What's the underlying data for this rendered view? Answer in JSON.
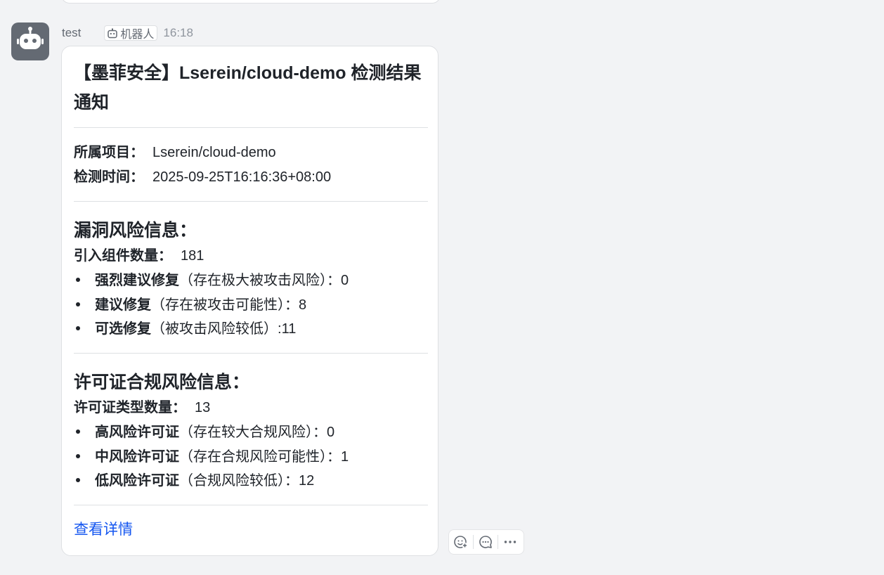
{
  "message": {
    "sender": "test",
    "bot_tag": "机器人",
    "time": "16:18"
  },
  "card": {
    "title": "【墨菲安全】Lserein/cloud-demo 检测结果通知",
    "project_label": "所属项目：",
    "project_value": "Lserein/cloud-demo",
    "time_label": "检测时间：",
    "time_value": "2025-09-25T16:16:36+08:00",
    "vuln": {
      "heading": "漏洞风险信息：",
      "count_label": "引入组件数量：",
      "count_value": "181",
      "items": [
        {
          "label": "强烈建议修复",
          "note": "（存在极大被攻击风险）：",
          "value": "0"
        },
        {
          "label": "建议修复",
          "note": "（存在被攻击可能性）：",
          "value": "8"
        },
        {
          "label": "可选修复",
          "note": "（被攻击风险较低）:",
          "value": "11"
        }
      ]
    },
    "license": {
      "heading": "许可证合规风险信息：",
      "count_label": "许可证类型数量：",
      "count_value": "13",
      "items": [
        {
          "label": "高风险许可证",
          "note": "（存在较大合规风险）：",
          "value": "0"
        },
        {
          "label": "中风险许可证",
          "note": "（存在合规风险可能性）：",
          "value": "1"
        },
        {
          "label": "低风险许可证",
          "note": "（合规风险较低）：",
          "value": "12"
        }
      ]
    },
    "link_label": "查看详情"
  },
  "actions": {
    "icons": [
      "add-reaction-icon",
      "reply-icon",
      "more-icon"
    ]
  }
}
